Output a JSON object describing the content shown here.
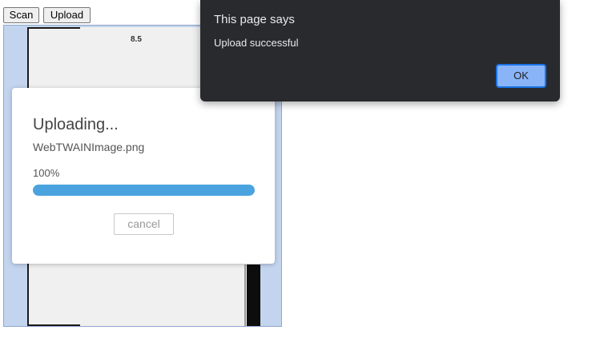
{
  "toolbar": {
    "scan_label": "Scan",
    "upload_label": "Upload"
  },
  "viewer": {
    "page_number": "8.5"
  },
  "upload_dialog": {
    "title": "Uploading...",
    "filename": "WebTWAINImage.png",
    "percent_text": "100%",
    "progress_fraction": 1.0,
    "cancel_label": "cancel"
  },
  "alert": {
    "title": "This page says",
    "message": "Upload successful",
    "ok_label": "OK"
  },
  "colors": {
    "progress": "#4aa3df",
    "alert_bg": "#292a2d",
    "ok_button": "#8ab4f8",
    "viewer_bg": "#c3d4ee"
  }
}
